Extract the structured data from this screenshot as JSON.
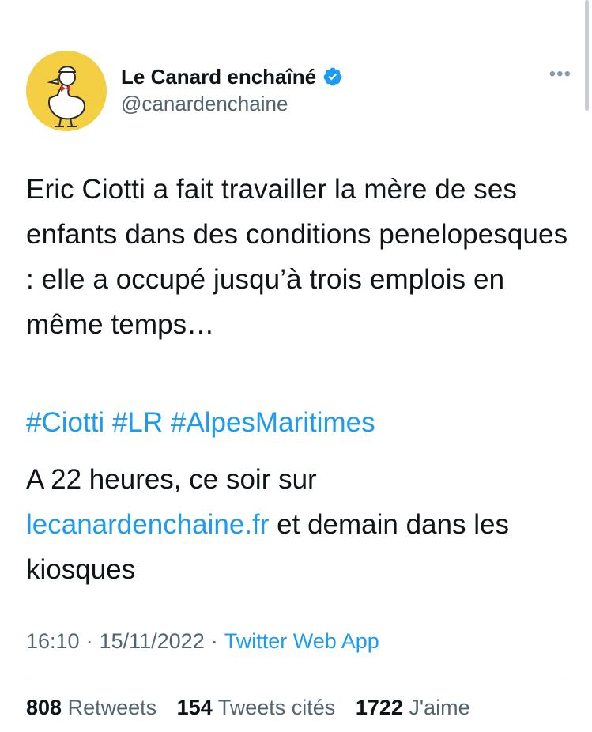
{
  "account": {
    "display_name": "Le Canard enchaîné",
    "handle": "@canardenchaine",
    "verified": true,
    "avatar_bg": "#f4cf43"
  },
  "more_icon": "more-dots-icon",
  "tweet": {
    "text": "Eric Ciotti a fait travailler la mère de ses enfants dans des conditions penelopesques : elle a occupé jusqu’à trois emplois en même temps…",
    "hashtags": [
      "#Ciotti",
      "#LR",
      "#AlpesMaritimes"
    ],
    "second_text_before": "A 22 heures, ce soir sur",
    "link": "lecanardenchaine.fr",
    "second_text_after": "et demain dans les kiosques"
  },
  "meta": {
    "time": "16:10",
    "separator": "·",
    "date": "15/11/2022",
    "source": "Twitter Web App"
  },
  "stats": {
    "retweets_count": "808",
    "retweets_label": "Retweets",
    "quotes_count": "154",
    "quotes_label": "Tweets cités",
    "likes_count": "1722",
    "likes_label": "J'aime"
  },
  "colors": {
    "link": "#1d9bf0",
    "secondary_text": "#536471",
    "primary_text": "#0f1419"
  }
}
